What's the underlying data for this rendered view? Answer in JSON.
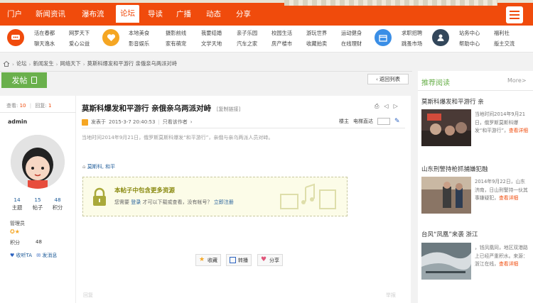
{
  "topnav": {
    "items": [
      "门户",
      "新闻资讯",
      "瀑布流",
      "论坛",
      "导读",
      "广播",
      "动态",
      "分享"
    ],
    "active_index": 3,
    "accent": "#f04b0c"
  },
  "subnav": {
    "groups": [
      {
        "icon": "forum-icon",
        "color": "#f04b0c",
        "links": [
          "活在春都",
          "聊天逸水",
          "网罗天下",
          "爱心公益"
        ]
      },
      {
        "icon": "heart-icon",
        "color": "#f5a623",
        "links": [
          "本地美食",
          "影音娱乐",
          "摄影前线",
          "家有萌宠",
          "我要结婚",
          "文学天地",
          "亲子乐园",
          "汽车之家",
          "校园生活",
          "房产楼市",
          "游玩世界",
          "收藏拍卖",
          "运动健身",
          "在线理财"
        ]
      },
      {
        "icon": "calendar-icon",
        "color": "#3a8ee6",
        "links": [
          "求职招聘",
          "跳蚤市场"
        ]
      },
      {
        "icon": "user-icon",
        "color": "#33475b",
        "links": [
          "站务中心",
          "帮助中心",
          "福利社",
          "版主交流"
        ]
      }
    ]
  },
  "breadcrumb": [
    "论坛",
    "新闻发生",
    "网络天下",
    "莫斯科爆发和平游行 亲俄亲乌两派对峙"
  ],
  "toolbar": {
    "post_label": "发帖",
    "back_label": "返回列表"
  },
  "post_stats": {
    "views_label": "查看:",
    "views": "10",
    "replies_label": "回复:",
    "replies": "1"
  },
  "author": {
    "name": "admin",
    "stats": [
      {
        "value": "14",
        "label": "主题"
      },
      {
        "value": "15",
        "label": "帖子"
      },
      {
        "value": "48",
        "label": "积分"
      }
    ],
    "role": "管理员",
    "points_label": "积分",
    "points": "48",
    "links": [
      "收听TA",
      "发消息"
    ]
  },
  "post": {
    "title": "莫斯科爆发和平游行 亲俄亲乌两派对峙",
    "title_tag": "[复制链接]",
    "posted_prefix": "发表于",
    "posted_at": "2015-3-7 20:40:53",
    "author_only": "只看该作者",
    "floor_label": "楼主",
    "jump_label": "电梯直达",
    "body": "当地时间2014年9月21日，俄罗斯莫斯科爆发“和平游行”，亲俄与亲乌两派人员对峙。",
    "tags": [
      "莫斯科",
      "和平"
    ],
    "locked_title": "本帖子中包含更多资源",
    "locked_text_prefix": "您需要",
    "locked_login": "登录",
    "locked_text_mid": "才可以下载或查看，没有帐号？",
    "locked_register": "立即注册",
    "actions": [
      "收藏",
      "转播",
      "分享"
    ],
    "faint_left": "回复",
    "faint_right": "举报"
  },
  "sidebar": {
    "title": "推荐阅读",
    "more": "More>",
    "items": [
      {
        "title": "莫斯科爆发和平游行 亲",
        "text": "当地时间2014年9月21日，俄罗斯莫斯科爆发“和平游行”，",
        "read_more": "查看详细"
      },
      {
        "title": "山东刑警持枪抓捕嫌犯融",
        "text": "2014年9月22日，山东济南，日山刑警持一伙其事嫌疑犯，",
        "read_more": "查看详细"
      },
      {
        "title": "台风“凤凰”来袭 浙江",
        "text": "，钱凤凰同，地区双港路上已经严重积水。",
        "extra": "来源：浙江在线，",
        "read_more": "查看详细"
      }
    ]
  }
}
